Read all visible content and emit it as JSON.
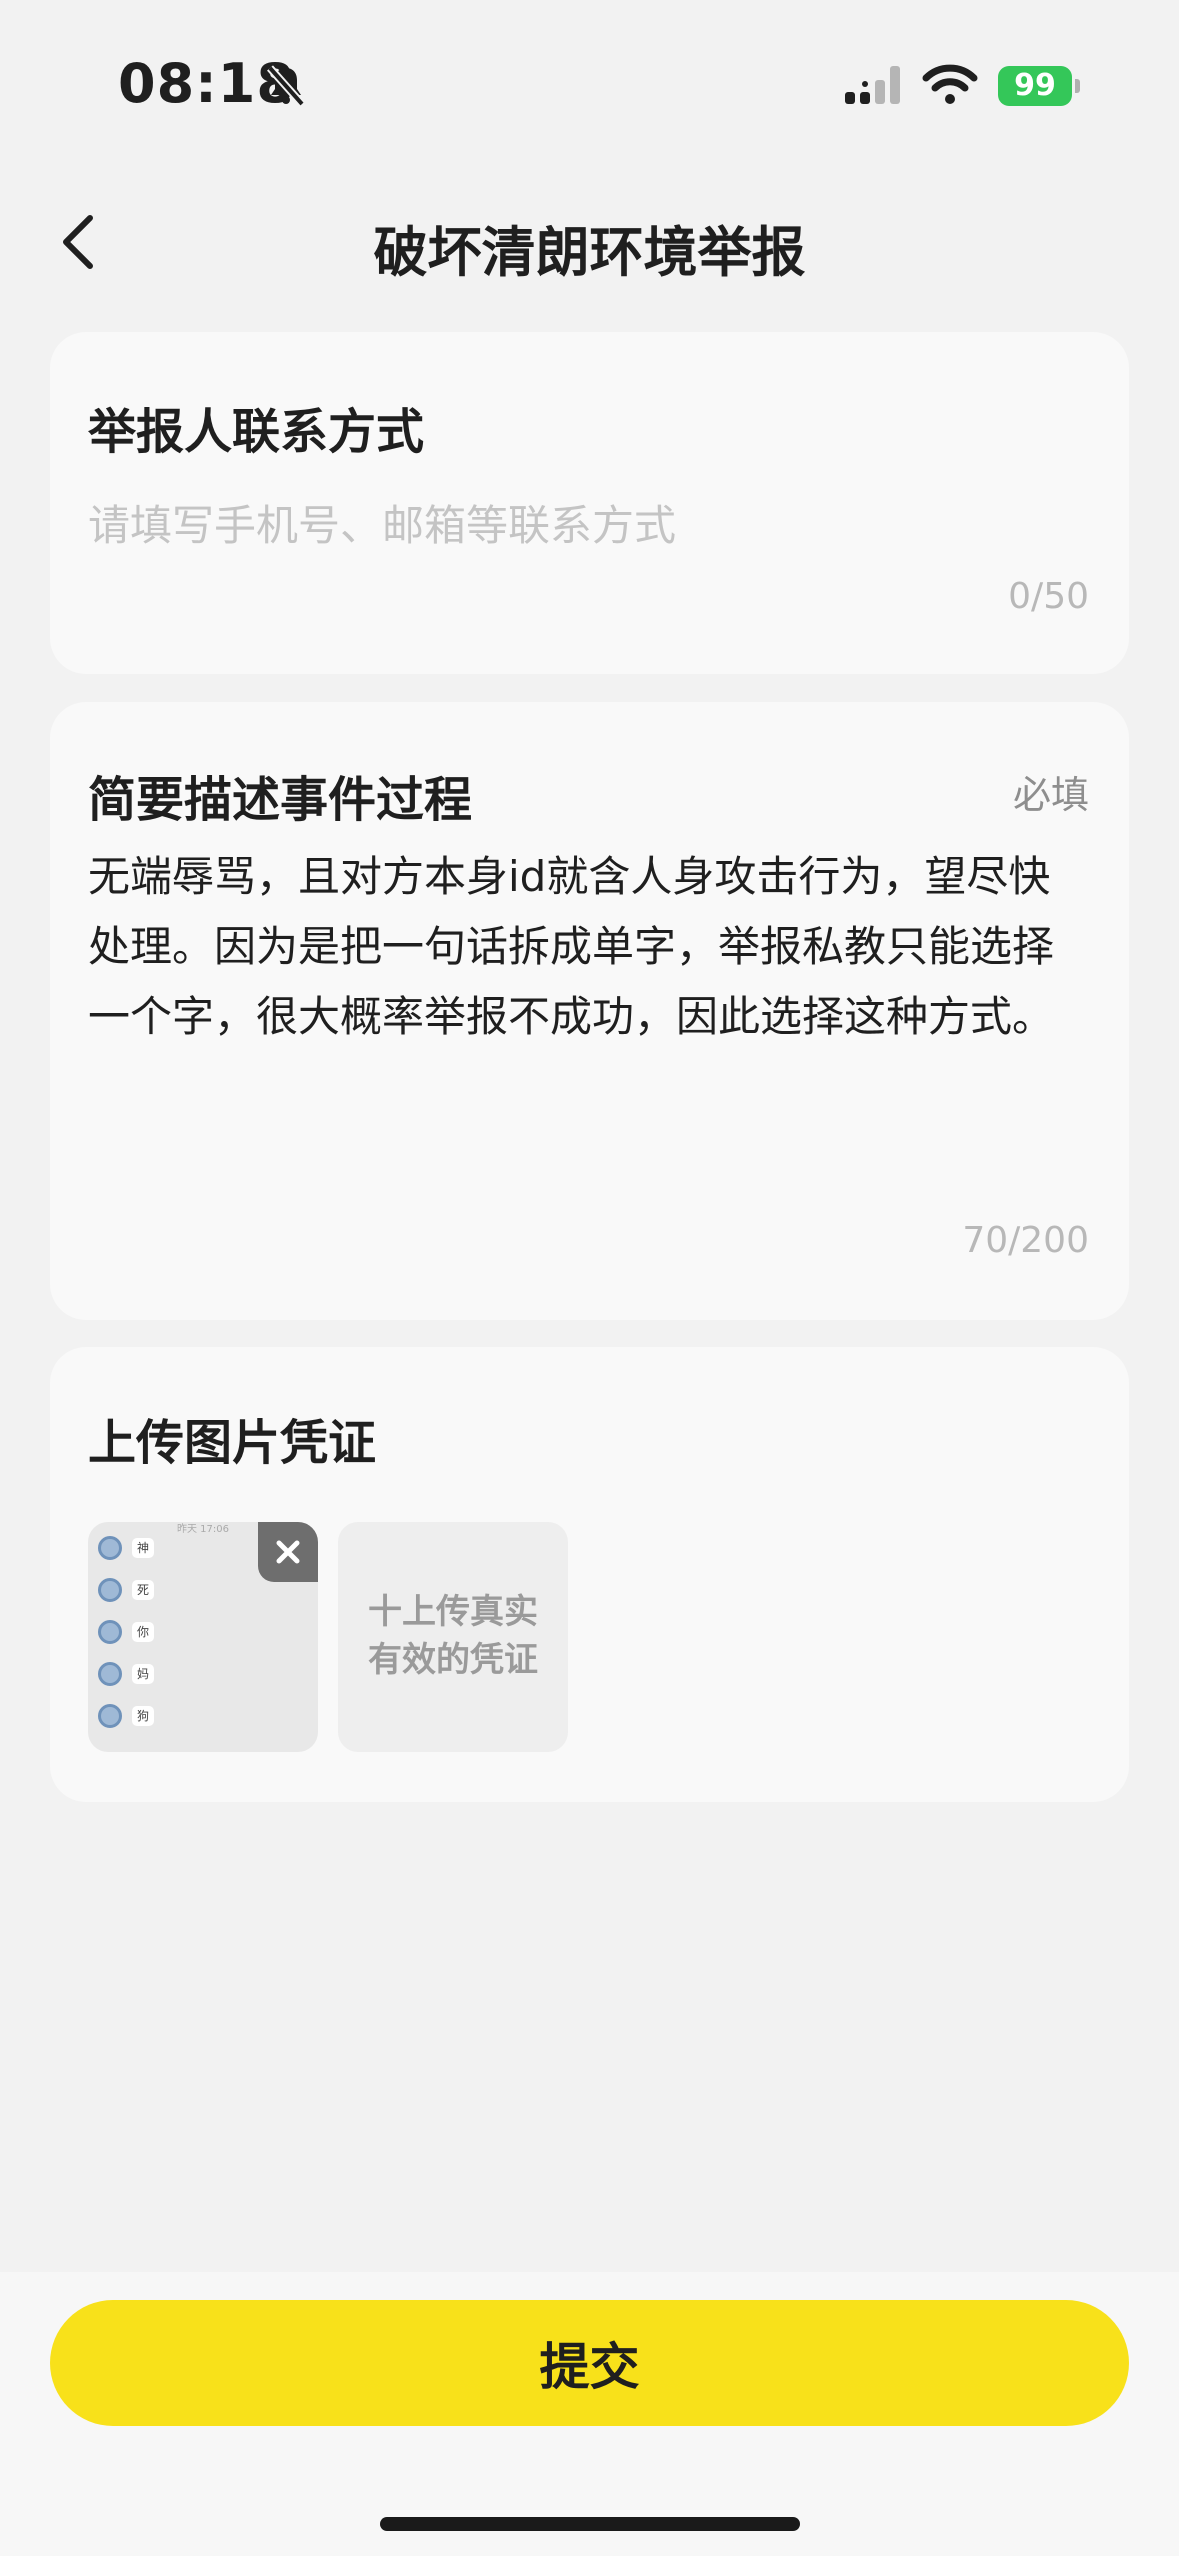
{
  "status_bar": {
    "time": "08:18",
    "battery": "99",
    "battery_color": "#34c759"
  },
  "nav": {
    "title": "破坏清朗环境举报"
  },
  "contact": {
    "title": "举报人联系方式",
    "placeholder": "请填写手机号、邮箱等联系方式",
    "counter": "0/50"
  },
  "description": {
    "title": "简要描述事件过程",
    "required": "必填",
    "text": "无端辱骂，且对方本身id就含人身攻击行为，望尽快处理。因为是把一句话拆成单字，举报私教只能选择一个字，很大概率举报不成功，因此选择这种方式。",
    "counter": "70/200"
  },
  "upload": {
    "title": "上传图片凭证",
    "thumbnail": {
      "header": "昨天 17:06",
      "chars": [
        "神",
        "死",
        "你",
        "妈",
        "狗"
      ]
    },
    "add_label_line1": "十上传真实",
    "add_label_line2": "有效的凭证"
  },
  "footer": {
    "submit_label": "提交",
    "accent_color": "#f8e11a"
  }
}
